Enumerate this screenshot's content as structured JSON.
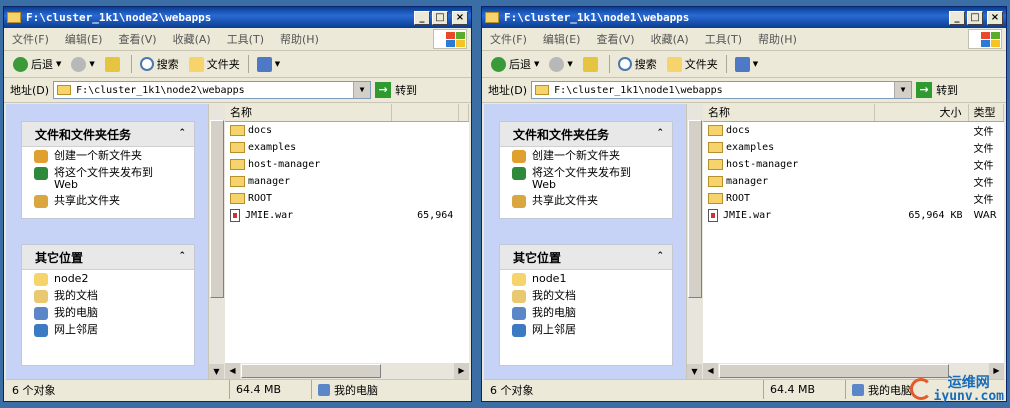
{
  "windows": [
    {
      "title": "F:\\cluster_1k1\\node2\\webapps",
      "menu": [
        "文件(F)",
        "编辑(E)",
        "查看(V)",
        "收藏(A)",
        "工具(T)",
        "帮助(H)"
      ],
      "toolbar": {
        "back": "后退",
        "search": "搜索",
        "folders": "文件夹"
      },
      "address": {
        "label": "地址(D)",
        "value": "F:\\cluster_1k1\\node2\\webapps",
        "go": "转到"
      },
      "tasks": {
        "title": "文件和文件夹任务",
        "items": [
          "创建一个新文件夹",
          "将这个文件夹发布到 Web",
          "共享此文件夹"
        ]
      },
      "places": {
        "title": "其它位置",
        "items": [
          "node2",
          "我的文档",
          "我的电脑",
          "网上邻居"
        ]
      },
      "columns": {
        "name": "名称",
        "size": "",
        "type": ""
      },
      "files": [
        {
          "name": "docs",
          "kind": "folder",
          "size": "",
          "type": ""
        },
        {
          "name": "examples",
          "kind": "folder",
          "size": "",
          "type": ""
        },
        {
          "name": "host-manager",
          "kind": "folder",
          "size": "",
          "type": ""
        },
        {
          "name": "manager",
          "kind": "folder",
          "size": "",
          "type": ""
        },
        {
          "name": "ROOT",
          "kind": "folder",
          "size": "",
          "type": ""
        },
        {
          "name": "JMIE.war",
          "kind": "war",
          "size": "65,964",
          "type": ""
        }
      ],
      "status": {
        "objects": "6 个对象",
        "size": "64.4 MB",
        "location": "我的电脑"
      }
    },
    {
      "title": "F:\\cluster_1k1\\node1\\webapps",
      "menu": [
        "文件(F)",
        "编辑(E)",
        "查看(V)",
        "收藏(A)",
        "工具(T)",
        "帮助(H)"
      ],
      "toolbar": {
        "back": "后退",
        "search": "搜索",
        "folders": "文件夹"
      },
      "address": {
        "label": "地址(D)",
        "value": "F:\\cluster_1k1\\node1\\webapps",
        "go": "转到"
      },
      "tasks": {
        "title": "文件和文件夹任务",
        "items": [
          "创建一个新文件夹",
          "将这个文件夹发布到 Web",
          "共享此文件夹"
        ]
      },
      "places": {
        "title": "其它位置",
        "items": [
          "node1",
          "我的文档",
          "我的电脑",
          "网上邻居"
        ]
      },
      "columns": {
        "name": "名称",
        "size": "大小",
        "type": "类型"
      },
      "files": [
        {
          "name": "docs",
          "kind": "folder",
          "size": "",
          "type": "文件"
        },
        {
          "name": "examples",
          "kind": "folder",
          "size": "",
          "type": "文件"
        },
        {
          "name": "host-manager",
          "kind": "folder",
          "size": "",
          "type": "文件"
        },
        {
          "name": "manager",
          "kind": "folder",
          "size": "",
          "type": "文件"
        },
        {
          "name": "ROOT",
          "kind": "folder",
          "size": "",
          "type": "文件"
        },
        {
          "name": "JMIE.war",
          "kind": "war",
          "size": "65,964 KB",
          "type": "WAR"
        }
      ],
      "status": {
        "objects": "6 个对象",
        "size": "64.4 MB",
        "location": "我的电脑"
      }
    }
  ],
  "watermark": {
    "line1": "运维网",
    "line2": "iyunv.com"
  }
}
